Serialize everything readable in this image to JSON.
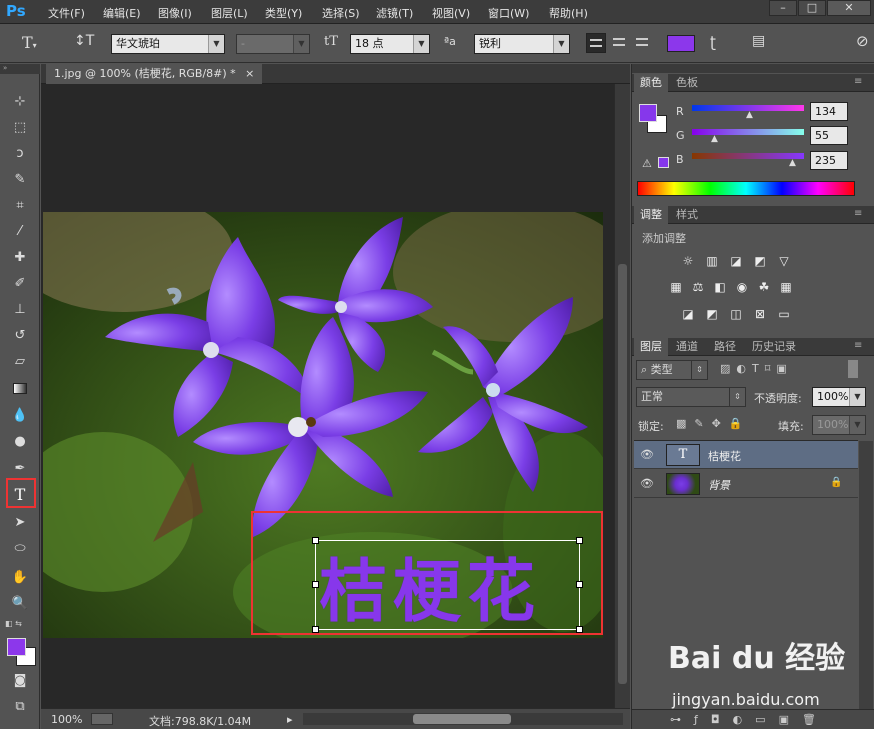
{
  "app": {
    "logo": "Ps",
    "menu": [
      "文件(F)",
      "编辑(E)",
      "图像(I)",
      "图层(L)",
      "类型(Y)",
      "选择(S)",
      "滤镜(T)",
      "视图(V)",
      "窗口(W)",
      "帮助(H)"
    ]
  },
  "options": {
    "font_family": "华文琥珀",
    "font_style": "-",
    "font_size": "18 点",
    "antialias": "锐利",
    "text_color": "#8c37eb"
  },
  "document": {
    "tab_title": "1.jpg @ 100% (桔梗花, RGB/8#) *",
    "close": "×",
    "text_layer_content": "桔梗花",
    "text_color": "#8737eb"
  },
  "status": {
    "zoom": "100%",
    "doc_info": "文档:798.8K/1.04M"
  },
  "color_panel": {
    "tabs": [
      "颜色",
      "色板"
    ],
    "r_label": "R",
    "g_label": "G",
    "b_label": "B",
    "r": "134",
    "g": "55",
    "b": "235",
    "fg": "#8637eb",
    "bg": "#ffffff"
  },
  "adjust_panel": {
    "tabs": [
      "调整",
      "样式"
    ],
    "title": "添加调整"
  },
  "layers_panel": {
    "tabs": [
      "图层",
      "通道",
      "路径",
      "历史记录"
    ],
    "filter": "类型",
    "blend_mode": "正常",
    "opacity_label": "不透明度:",
    "opacity": "100%",
    "lock_label": "锁定:",
    "fill_label": "填充:",
    "fill": "100%",
    "layers": [
      {
        "name": "桔梗花",
        "type": "text",
        "selected": true
      },
      {
        "name": "背景",
        "type": "image",
        "locked": true
      }
    ]
  },
  "watermark": {
    "brand": "Bai du 经验",
    "url": "jingyan.baidu.com"
  }
}
